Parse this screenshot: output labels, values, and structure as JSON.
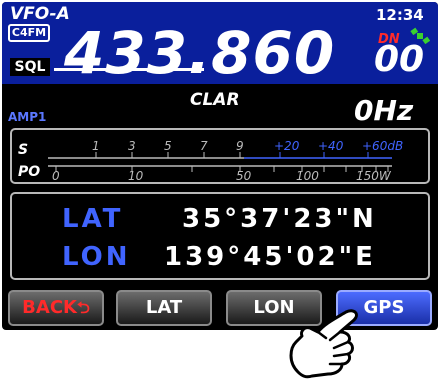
{
  "header": {
    "vfo": "VFO-A",
    "mode": "C4FM",
    "time": "12:34",
    "sql": "SQL"
  },
  "frequency": {
    "main": "433.860",
    "small": "00",
    "indicator": "DN"
  },
  "clar": {
    "label": "CLAR",
    "offset": "0Hz",
    "amp": "AMP1"
  },
  "meter": {
    "s_label": "S",
    "po_label": "PO",
    "s_ticks": [
      "1",
      "3",
      "5",
      "7",
      "9",
      "+20",
      "+40",
      "+60dB"
    ],
    "po_ticks": [
      "0",
      "10",
      "50",
      "100",
      "150W"
    ]
  },
  "position": {
    "lat_label": "LAT",
    "lat_value": "35°37'23\"N",
    "lon_label": "LON",
    "lon_value": "139°45'02\"E"
  },
  "buttons": {
    "back": "BACK",
    "lat": "LAT",
    "lon": "LON",
    "gps": "GPS"
  },
  "colors": {
    "band": "#0a1f9c",
    "accent": "#4064ff",
    "alert": "#ff2a2a"
  }
}
